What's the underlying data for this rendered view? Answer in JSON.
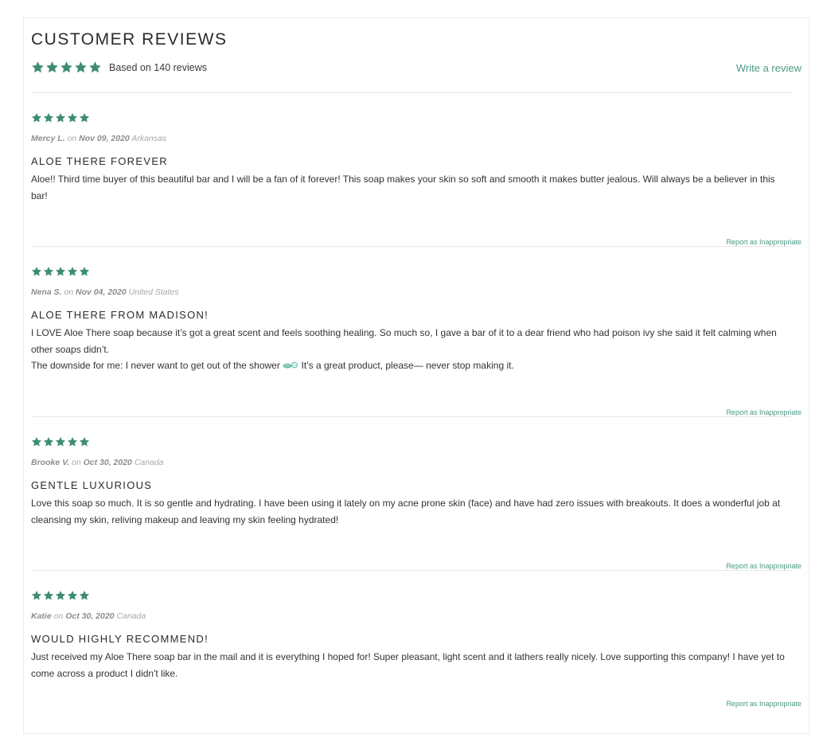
{
  "header": {
    "title": "CUSTOMER REVIEWS",
    "summary_text": "Based on 140 reviews",
    "summary_rating": 5,
    "write_review_label": "Write a review"
  },
  "colors": {
    "accent": "#4a9985",
    "star": "#3f8c76",
    "divider": "#e8e8e8"
  },
  "reviews": [
    {
      "rating": 5,
      "author": "Mercy L.",
      "on": "on",
      "date": "Nov 09, 2020",
      "location": "Arkansas",
      "title": "ALOE THERE FOREVER",
      "body": [
        "Aloe!! Third time buyer of this beautiful bar and I will be a fan of it forever! This soap makes your skin so soft and smooth it makes butter jealous. Will always be a believer in this bar!"
      ],
      "report_label": "Report as Inappropriate"
    },
    {
      "rating": 5,
      "author": "Nena S.",
      "on": "on",
      "date": "Nov 04, 2020",
      "location": "United States",
      "title": "ALOE THERE FROM MADISON!",
      "body": [
        "I LOVE Aloe There soap because it’s got a great scent and feels soothing healing. So much so, I gave a bar of it to a dear friend who had poison ivy she said it felt calming when other soaps didn’t.",
        "The downside for me: I never want to get out of the shower",
        "It’s a great product, please— never stop making it."
      ],
      "report_label": "Report as Inappropriate"
    },
    {
      "rating": 5,
      "author": "Brooke V.",
      "on": "on",
      "date": "Oct 30, 2020",
      "location": "Canada",
      "title": "GENTLE LUXURIOUS",
      "body": [
        "Love this soap so much. It is so gentle and hydrating. I have been using it lately on my acne prone skin (face) and have had zero issues with breakouts. It does a wonderful job at cleansing my skin, reliving makeup and leaving my skin feeling hydrated!"
      ],
      "report_label": "Report as Inappropriate"
    },
    {
      "rating": 5,
      "author": "Katie",
      "on": "on",
      "date": "Oct 30, 2020",
      "location": "Canada",
      "title": "WOULD HIGHLY RECOMMEND!",
      "body": [
        "Just received my Aloe There soap bar in the mail and it is everything I hoped for! Super pleasant, light scent and it lathers really nicely. Love supporting this company! I have yet to come across a product I didn't like."
      ],
      "report_label": "Report as Inappropriate"
    }
  ]
}
